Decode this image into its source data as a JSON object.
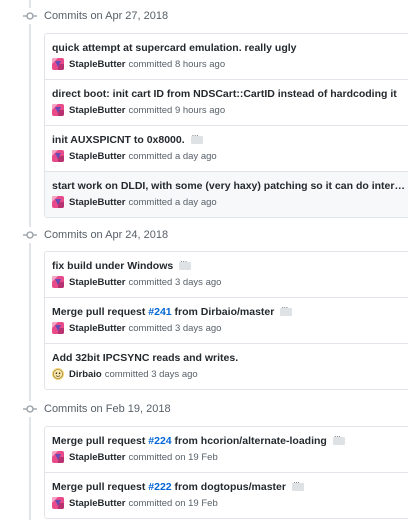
{
  "colors": {
    "link": "#0366d6",
    "border": "#e1e4e8",
    "muted": "#586069",
    "text": "#24292e"
  },
  "groups": [
    {
      "title": "Commits on Apr 27, 2018",
      "commits": [
        {
          "message": "quick attempt at supercard emulation. really ugly",
          "author": "StapleButter",
          "time": "committed 8 hours ago",
          "avatar": "staplebutter-avatar",
          "has_ellipsis": false
        },
        {
          "message": "direct boot: init cart ID from NDSCart::CartID instead of hardcoding it",
          "author": "StapleButter",
          "time": "committed 9 hours ago",
          "avatar": "staplebutter-avatar",
          "has_ellipsis": false
        },
        {
          "message": "init AUXSPICNT to 0x8000.",
          "author": "StapleButter",
          "time": "committed a day ago",
          "avatar": "staplebutter-avatar",
          "has_ellipsis": true
        },
        {
          "message": "start work on DLDI, with some (very haxy) patching so it can do inter…",
          "author": "StapleButter",
          "time": "committed a day ago",
          "avatar": "staplebutter-avatar",
          "has_ellipsis": true
        }
      ]
    },
    {
      "title": "Commits on Apr 24, 2018",
      "commits": [
        {
          "message": "fix build under Windows",
          "author": "StapleButter",
          "time": "committed 3 days ago",
          "avatar": "staplebutter-avatar",
          "has_ellipsis": true
        },
        {
          "message_prefix": "Merge pull request ",
          "pr": "#241",
          "message_suffix": " from Dirbaio/master",
          "author": "StapleButter",
          "time": "committed 3 days ago",
          "avatar": "staplebutter-avatar",
          "has_ellipsis": true
        },
        {
          "message": "Add 32bit IPCSYNC reads and writes.",
          "author": "Dirbaio",
          "time": "committed 3 days ago",
          "avatar": "dirbaio-avatar",
          "has_ellipsis": false
        }
      ]
    },
    {
      "title": "Commits on Feb 19, 2018",
      "commits": [
        {
          "message_prefix": "Merge pull request ",
          "pr": "#224",
          "message_suffix": " from hcorion/alternate-loading",
          "author": "StapleButter",
          "time": "committed on 19 Feb",
          "avatar": "staplebutter-avatar",
          "has_ellipsis": true
        },
        {
          "message_prefix": "Merge pull request ",
          "pr": "#222",
          "message_suffix": " from dogtopus/master",
          "author": "StapleButter",
          "time": "committed on 19 Feb",
          "avatar": "staplebutter-avatar",
          "has_ellipsis": true
        }
      ]
    }
  ]
}
